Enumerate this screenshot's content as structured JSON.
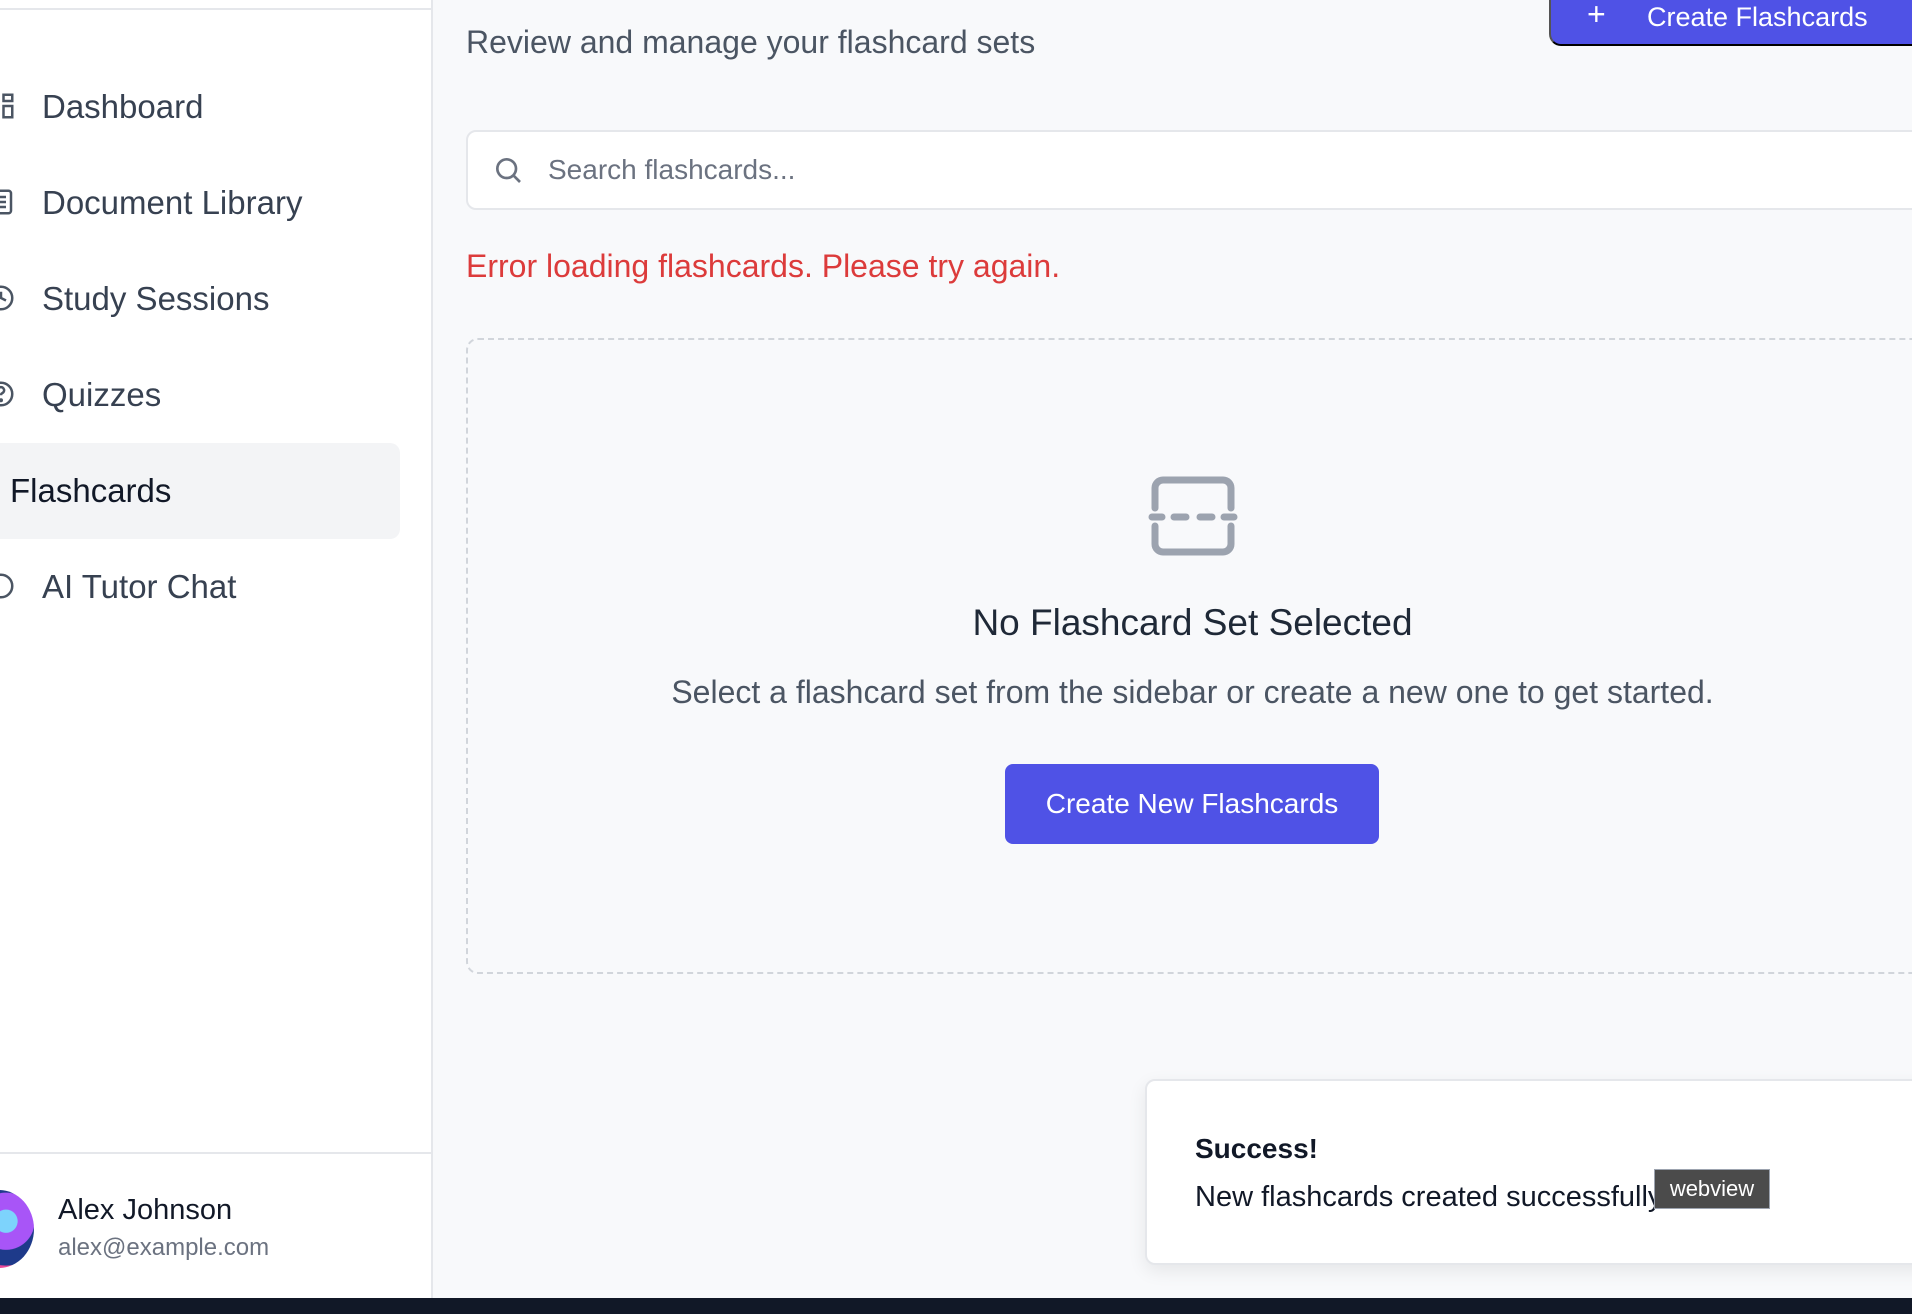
{
  "sidebar": {
    "items": [
      {
        "label": "Dashboard",
        "icon": "dashboard-icon"
      },
      {
        "label": "Document Library",
        "icon": "document-icon"
      },
      {
        "label": "Study Sessions",
        "icon": "clock-icon"
      },
      {
        "label": "Quizzes",
        "icon": "question-icon"
      },
      {
        "label": "Flashcards",
        "icon": "flashcards-icon",
        "active": true
      },
      {
        "label": "AI Tutor Chat",
        "icon": "chat-icon"
      }
    ],
    "user": {
      "name": "Alex Johnson",
      "email": "alex@example.com"
    }
  },
  "header": {
    "subtitle": "Review and manage your flashcard sets",
    "create_button": "Create Flashcards"
  },
  "search": {
    "placeholder": "Search flashcards..."
  },
  "error": "Error loading flashcards. Please try again.",
  "empty_state": {
    "title": "No Flashcard Set Selected",
    "text": "Select a flashcard set from the sidebar or create a new one to get started.",
    "button": "Create New Flashcards"
  },
  "toast": {
    "title": "Success!",
    "message": "New flashcards created successfully"
  },
  "tooltip": "webview",
  "colors": {
    "accent": "#4f52e6",
    "error": "#dc3b3b"
  }
}
